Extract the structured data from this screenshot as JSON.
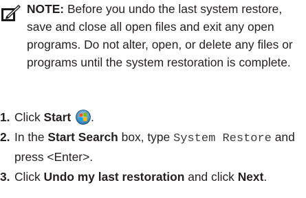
{
  "note": {
    "icon": "note-icon",
    "label": "NOTE:",
    "text": " Before you undo the last system restore, save and close all open files and exit any open programs. Do not alter, open, or delete any files or programs until the system restoration is complete."
  },
  "steps": [
    {
      "num": "1.",
      "pre": "Click ",
      "bold": "Start",
      "icon": "windows-start-icon"
    },
    {
      "num": "2.",
      "pre": "In the ",
      "bold": "Start Search",
      "mid": " box, type ",
      "code": "System Restore",
      "post": " and press <Enter>."
    },
    {
      "num": "3.",
      "pre": "Click ",
      "bold": "Undo my last restoration",
      "mid": " and click ",
      "bold2": "Next",
      "post": "."
    }
  ]
}
